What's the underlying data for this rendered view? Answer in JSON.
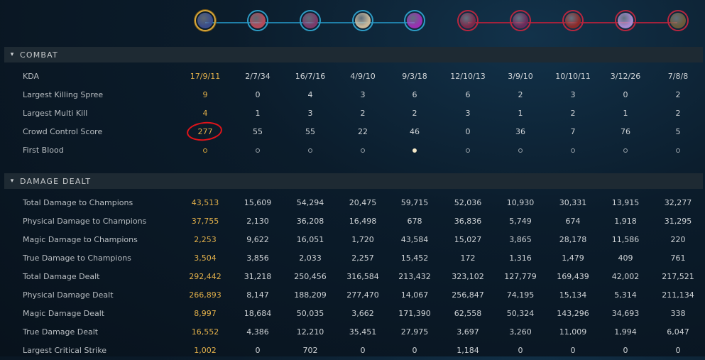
{
  "champions": [
    {
      "team": "blue",
      "me": true,
      "tint": "#3a4c8a",
      "icon": "champion-portrait-icon"
    },
    {
      "team": "blue",
      "tint": "#b34a5a",
      "icon": "champion-portrait-icon"
    },
    {
      "team": "blue",
      "tint": "#7a3a6a",
      "icon": "champion-portrait-icon"
    },
    {
      "team": "blue",
      "tint": "#c8b89a",
      "icon": "champion-portrait-icon"
    },
    {
      "team": "blue",
      "tint": "#9b2fb3",
      "icon": "champion-portrait-icon"
    },
    {
      "team": "red",
      "tint": "#7a2a4a",
      "icon": "champion-portrait-icon"
    },
    {
      "team": "red",
      "tint": "#6a2a5a",
      "icon": "champion-portrait-icon"
    },
    {
      "team": "red",
      "tint": "#8a2a2a",
      "icon": "champion-portrait-icon"
    },
    {
      "team": "red",
      "tint": "#a78ad0",
      "icon": "champion-portrait-icon"
    },
    {
      "team": "red",
      "tint": "#6a5a3a",
      "icon": "champion-portrait-icon"
    }
  ],
  "sections": {
    "combat": {
      "title": "COMBAT",
      "rows": [
        {
          "label": "KDA",
          "values": [
            "17/9/11",
            "2/7/34",
            "16/7/16",
            "4/9/10",
            "9/3/18",
            "12/10/13",
            "3/9/10",
            "10/10/11",
            "3/12/26",
            "7/8/8"
          ]
        },
        {
          "label": "Largest Killing Spree",
          "values": [
            "9",
            "0",
            "4",
            "3",
            "6",
            "6",
            "2",
            "3",
            "0",
            "2"
          ]
        },
        {
          "label": "Largest Multi Kill",
          "values": [
            "4",
            "1",
            "3",
            "2",
            "2",
            "3",
            "1",
            "2",
            "1",
            "2"
          ]
        },
        {
          "label": "Crowd Control Score",
          "values": [
            "277",
            "55",
            "55",
            "22",
            "46",
            "0",
            "36",
            "7",
            "76",
            "5"
          ]
        },
        {
          "label": "First Blood",
          "dots": [
            false,
            false,
            false,
            false,
            true,
            false,
            false,
            false,
            false,
            false
          ]
        }
      ]
    },
    "damage": {
      "title": "DAMAGE DEALT",
      "rows": [
        {
          "label": "Total Damage to Champions",
          "values": [
            "43,513",
            "15,609",
            "54,294",
            "20,475",
            "59,715",
            "52,036",
            "10,930",
            "30,331",
            "13,915",
            "32,277"
          ]
        },
        {
          "label": "Physical Damage to Champions",
          "values": [
            "37,755",
            "2,130",
            "36,208",
            "16,498",
            "678",
            "36,836",
            "5,749",
            "674",
            "1,918",
            "31,295"
          ]
        },
        {
          "label": "Magic Damage to Champions",
          "values": [
            "2,253",
            "9,622",
            "16,051",
            "1,720",
            "43,584",
            "15,027",
            "3,865",
            "28,178",
            "11,586",
            "220"
          ]
        },
        {
          "label": "True Damage to Champions",
          "values": [
            "3,504",
            "3,856",
            "2,033",
            "2,257",
            "15,452",
            "172",
            "1,316",
            "1,479",
            "409",
            "761"
          ]
        },
        {
          "label": "Total Damage Dealt",
          "values": [
            "292,442",
            "31,218",
            "250,456",
            "316,584",
            "213,432",
            "323,102",
            "127,779",
            "169,439",
            "42,002",
            "217,521"
          ]
        },
        {
          "label": "Physical Damage Dealt",
          "values": [
            "266,893",
            "8,147",
            "188,209",
            "277,470",
            "14,067",
            "256,847",
            "74,195",
            "15,134",
            "5,314",
            "211,134"
          ]
        },
        {
          "label": "Magic Damage Dealt",
          "values": [
            "8,997",
            "18,684",
            "50,035",
            "3,662",
            "171,390",
            "62,558",
            "50,324",
            "143,296",
            "34,693",
            "338"
          ]
        },
        {
          "label": "True Damage Dealt",
          "values": [
            "16,552",
            "4,386",
            "12,210",
            "35,451",
            "27,975",
            "3,697",
            "3,260",
            "11,009",
            "1,994",
            "6,047"
          ]
        },
        {
          "label": "Largest Critical Strike",
          "values": [
            "1,002",
            "0",
            "702",
            "0",
            "0",
            "1,184",
            "0",
            "0",
            "0",
            "0"
          ]
        }
      ]
    }
  }
}
